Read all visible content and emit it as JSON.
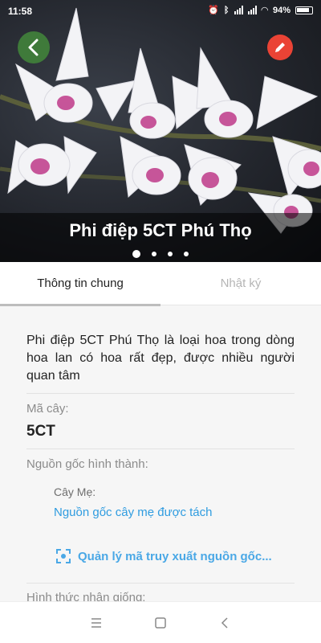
{
  "status_bar": {
    "time": "11:58",
    "battery": "94%"
  },
  "hero": {
    "title": "Phi điệp 5CT Phú Thọ",
    "slide_count": 4,
    "active_slide": 1,
    "back_button_color": "#3f7a3a",
    "edit_button_color": "#ea4335"
  },
  "tabs": [
    {
      "label": "Thông tin chung",
      "active": true
    },
    {
      "label": "Nhật ký",
      "active": false
    }
  ],
  "info": {
    "description": "Phi điệp 5CT Phú Thọ là loại hoa trong dòng hoa lan có hoa rất đẹp, được nhiều người quan tâm",
    "code_label": "Mã cây:",
    "code_value": "5CT",
    "origin_label": "Nguồn gốc hình thành:",
    "mother_label": "Cây Mẹ:",
    "mother_link": "Nguồn gốc cây mẹ được tách",
    "manage_link": "Quản lý mã truy xuất nguồn gốc...",
    "propagation_label": "Hình thức nhân giống:"
  },
  "nav": {
    "icons": [
      "menu-icon",
      "home-square-icon",
      "back-triangle-icon"
    ]
  }
}
